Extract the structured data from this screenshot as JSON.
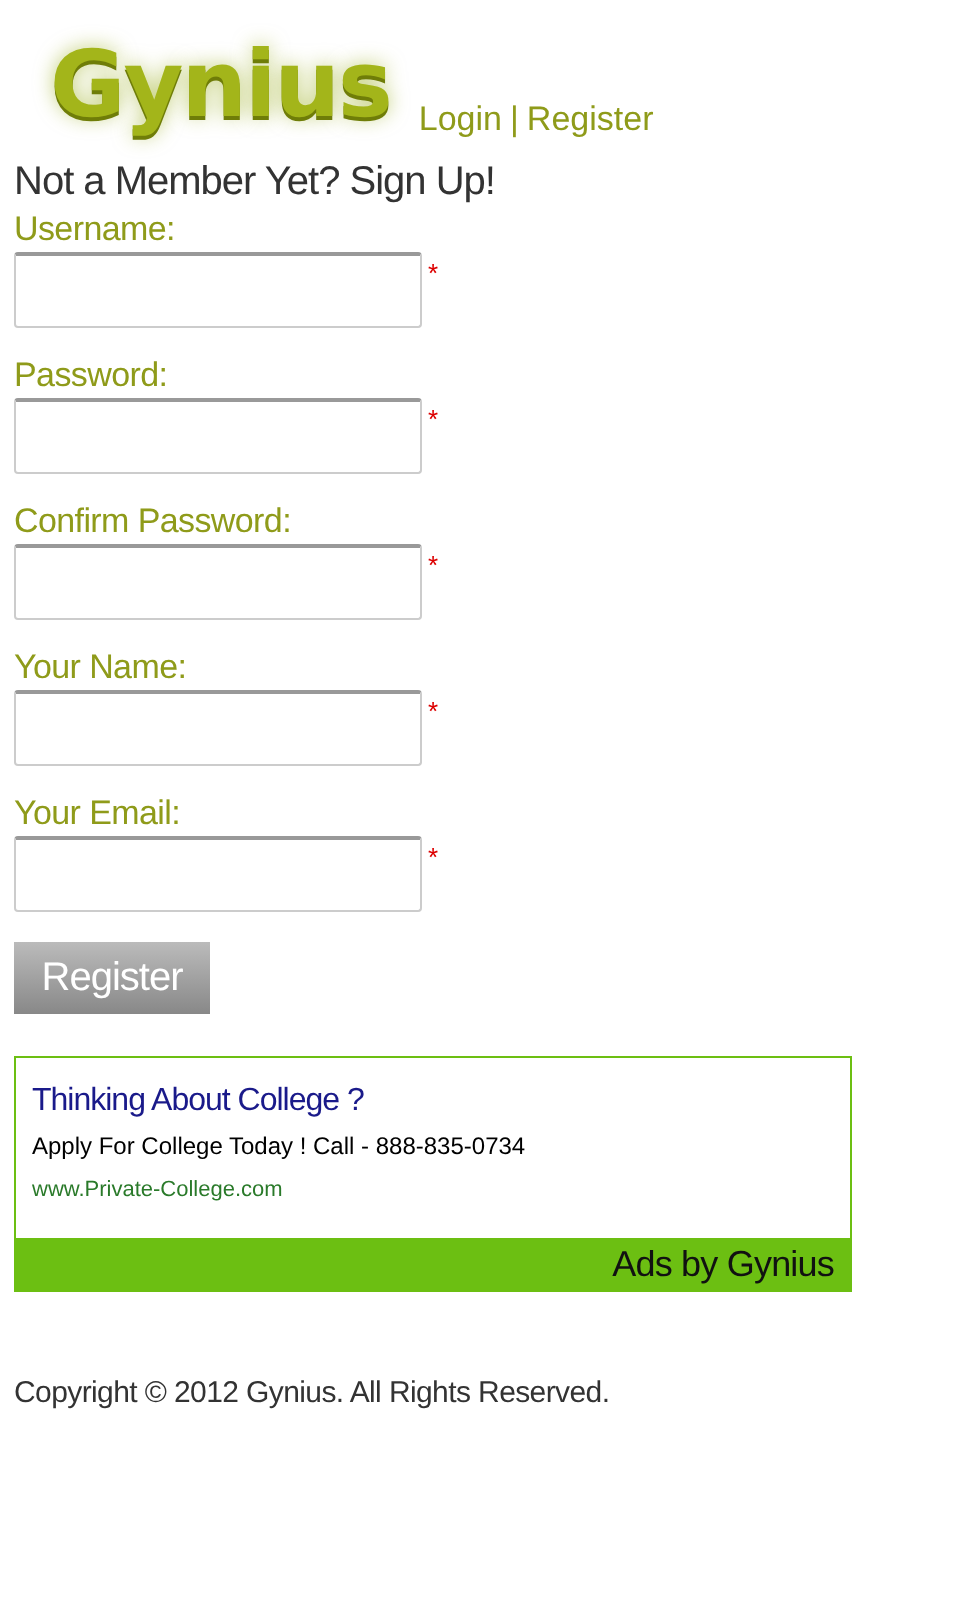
{
  "header": {
    "logo": "Gynius",
    "links": [
      {
        "label": "Login"
      },
      {
        "label": "Register"
      }
    ],
    "separator": "|"
  },
  "heading": "Not a Member Yet? Sign Up!",
  "fields": [
    {
      "label": "Username:",
      "required": true,
      "mark": "*"
    },
    {
      "label": "Password:",
      "required": true,
      "mark": "*"
    },
    {
      "label": "Confirm Password:",
      "required": true,
      "mark": "*"
    },
    {
      "label": "Your Name:",
      "required": true,
      "mark": "*"
    },
    {
      "label": "Your Email:",
      "required": true,
      "mark": "*"
    }
  ],
  "submit": "Register",
  "ad": {
    "title": "Thinking About College ?",
    "text": "Apply For College Today ! Call - 888-835-0734",
    "url": "www.Private-College.com",
    "footer": "Ads by Gynius"
  },
  "copyright": "Copyright © 2012 Gynius. All Rights Reserved."
}
